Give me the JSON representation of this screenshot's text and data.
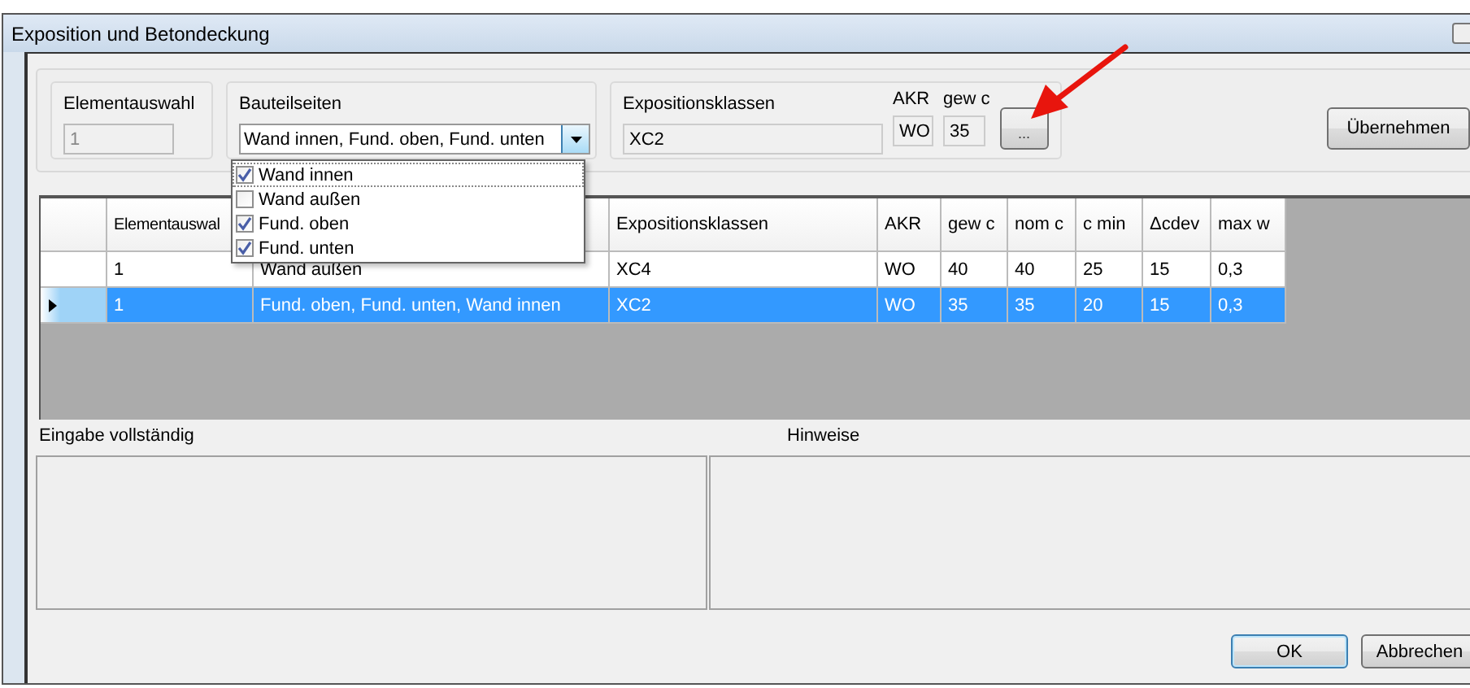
{
  "window": {
    "title": "Exposition und Betondeckung"
  },
  "element_selection": {
    "label": "Elementauswahl",
    "value": "1",
    "disabled": true
  },
  "component_sides": {
    "label": "Bauteilseiten",
    "value": "Wand innen, Fund. oben, Fund. unten",
    "expanded": true,
    "options": [
      {
        "label": "Wand innen",
        "checked": true
      },
      {
        "label": "Wand außen",
        "checked": false
      },
      {
        "label": "Fund. oben",
        "checked": true
      },
      {
        "label": "Fund. unten",
        "checked": true
      }
    ]
  },
  "exposure": {
    "label": "Expositionsklassen",
    "value": "XC2",
    "akr_label": "AKR",
    "akr_value": "WO",
    "cover_label": "gew c",
    "cover_value": "35",
    "browse_button": "..."
  },
  "apply_button": "Übernehmen",
  "table": {
    "columns": [
      {
        "label": "Elementauswal"
      },
      {},
      {
        "label": "Expositionsklassen"
      },
      {
        "label": "AKR"
      },
      {
        "label": "gew c"
      },
      {
        "label": "nom c"
      },
      {
        "label": "c min"
      },
      {
        "label": "Δcdev"
      },
      {
        "label": "max w"
      }
    ],
    "rows": [
      {
        "selected": false,
        "cells": [
          "1",
          "Wand außen",
          "XC4",
          "WO",
          "40",
          "40",
          "25",
          "15",
          "0,3"
        ]
      },
      {
        "selected": true,
        "cells": [
          "1",
          "Fund. oben, Fund. unten, Wand innen",
          "XC2",
          "WO",
          "35",
          "35",
          "20",
          "15",
          "0,3"
        ]
      }
    ]
  },
  "messages": {
    "complete_label": "Eingabe vollständig",
    "notes_label": "Hinweise"
  },
  "buttons": [
    {
      "label": "OK",
      "default": true
    },
    {
      "label": "Abbrechen",
      "default": false
    }
  ]
}
